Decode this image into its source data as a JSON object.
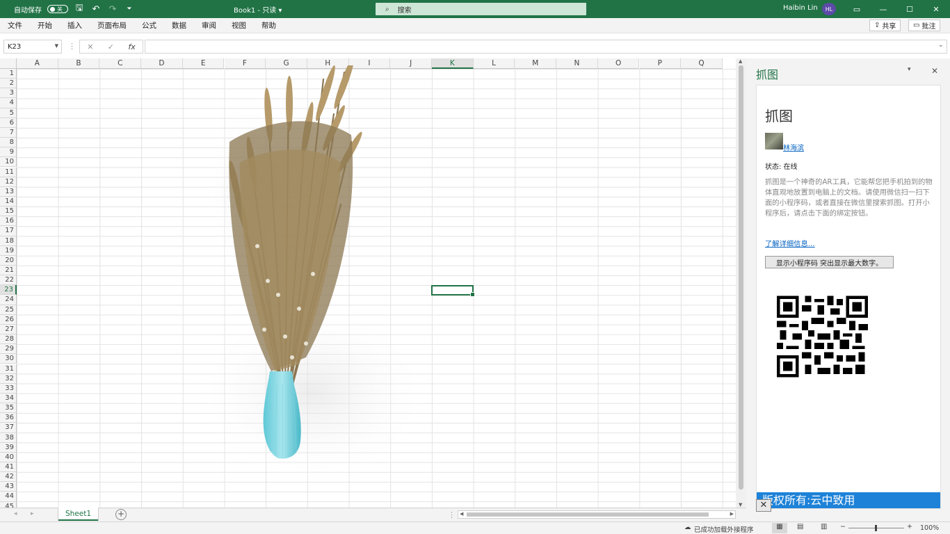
{
  "titlebar": {
    "autosave_label": "自动保存",
    "autosave_state": "关",
    "doc_title": "Book1  -  只读  ▾",
    "search_placeholder": "搜索",
    "user_name": "Haibin Lin",
    "user_initials": "HL"
  },
  "menu": [
    "文件",
    "开始",
    "插入",
    "页面布局",
    "公式",
    "数据",
    "审阅",
    "视图",
    "帮助"
  ],
  "share_label": "共享",
  "comment_label": "批注",
  "formula": {
    "name_box": "K23",
    "fx": "fx",
    "value": ""
  },
  "columns": [
    "A",
    "B",
    "C",
    "D",
    "E",
    "F",
    "G",
    "H",
    "I",
    "J",
    "K",
    "L",
    "M",
    "N",
    "O",
    "P",
    "Q"
  ],
  "selected_column": "K",
  "selected_row": 23,
  "rows": [
    1,
    2,
    3,
    4,
    5,
    6,
    7,
    8,
    9,
    10,
    11,
    12,
    13,
    14,
    15,
    16,
    17,
    18,
    19,
    20,
    21,
    22,
    23,
    24,
    25,
    26,
    27,
    28,
    29,
    30,
    31,
    32,
    33,
    34,
    35,
    36,
    37,
    38,
    39,
    40,
    41,
    42,
    43,
    44,
    45
  ],
  "sheet_tab": "Sheet1",
  "status": {
    "addins": "已成功加载外接程序",
    "zoom": "100%"
  },
  "pane": {
    "title": "抓图",
    "body_title": "抓图",
    "user_link": "林海滨",
    "status": "状态:  在线",
    "description": "抓图是一个神奇的AR工具，它能帮您把手机拍到的物体直观地放置到电脑上的文档。请使用微信扫一扫下面的小程序码，或者直接在微信里搜索抓图。打开小程序后，请点击下面的绑定按钮。",
    "learn_more": "了解详细信息...",
    "button_label": "显示小程序码 突出显示最大数字。",
    "footer": "版权所有:云中致用",
    "close": "✕"
  }
}
